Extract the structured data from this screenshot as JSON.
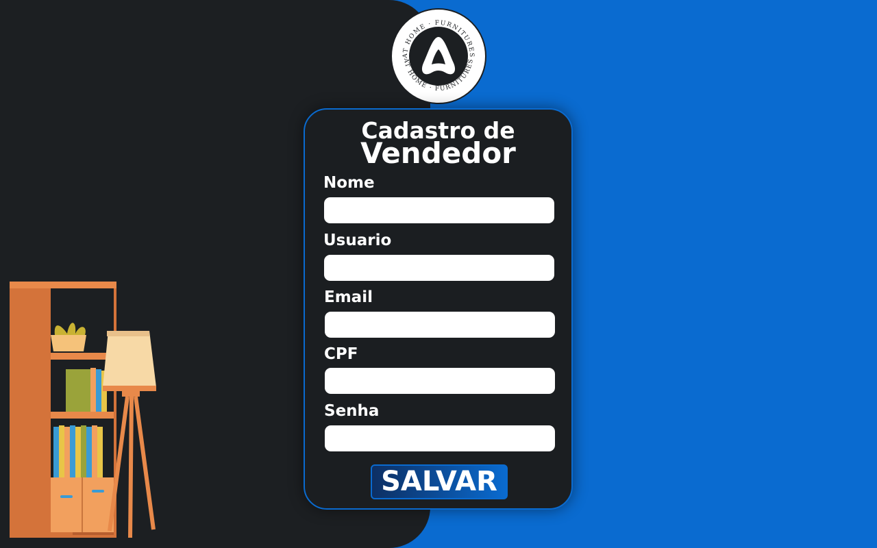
{
  "brand": {
    "logo_top_text": "AT HOME · FURNITURES",
    "logo_bottom_text": "AT HOME · FURNITURES"
  },
  "form": {
    "title_line1": "Cadastro de",
    "title_line2": "Vendedor",
    "fields": [
      {
        "label": "Nome",
        "value": "",
        "placeholder": ""
      },
      {
        "label": "Usuario",
        "value": "",
        "placeholder": ""
      },
      {
        "label": "Email",
        "value": "",
        "placeholder": ""
      },
      {
        "label": "CPF",
        "value": "",
        "placeholder": ""
      },
      {
        "label": "Senha",
        "value": "",
        "placeholder": ""
      }
    ],
    "submit_label": "SALVAR"
  },
  "colors": {
    "accent_blue": "#0a6bd0",
    "dark_bg": "#1c1f22",
    "card_bg": "#1b1e21"
  }
}
